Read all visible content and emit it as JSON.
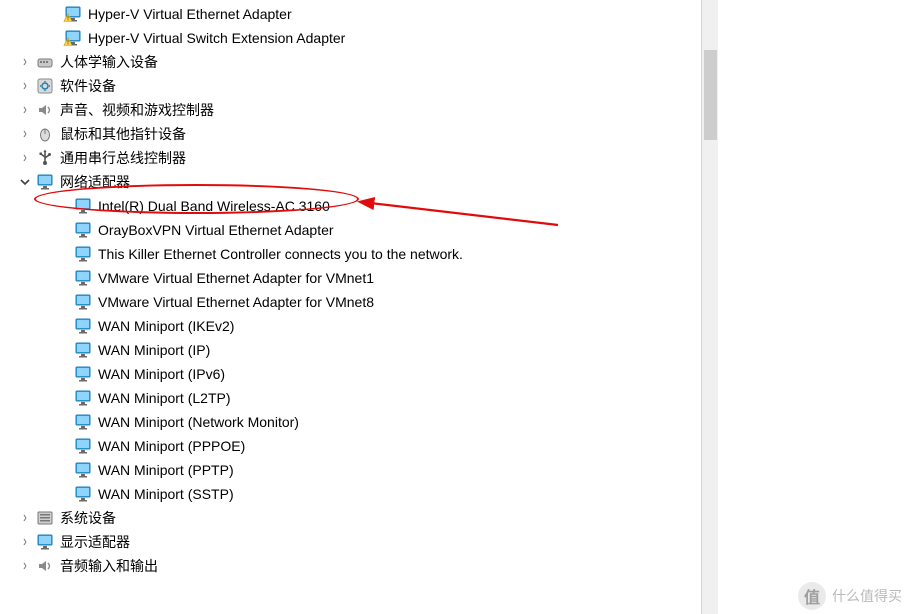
{
  "tree": {
    "items": [
      {
        "indent": 46,
        "chev": "",
        "icon": "net-warn",
        "label": "Hyper-V Virtual Ethernet Adapter"
      },
      {
        "indent": 46,
        "chev": "",
        "icon": "net-warn",
        "label": "Hyper-V Virtual Switch Extension Adapter"
      },
      {
        "indent": 18,
        "chev": "right",
        "icon": "hid",
        "label": "人体学输入设备"
      },
      {
        "indent": 18,
        "chev": "right",
        "icon": "software",
        "label": "软件设备"
      },
      {
        "indent": 18,
        "chev": "right",
        "icon": "audio",
        "label": "声音、视频和游戏控制器"
      },
      {
        "indent": 18,
        "chev": "right",
        "icon": "mouse",
        "label": "鼠标和其他指针设备"
      },
      {
        "indent": 18,
        "chev": "right",
        "icon": "usb",
        "label": "通用串行总线控制器"
      },
      {
        "indent": 18,
        "chev": "down",
        "icon": "network",
        "label": "网络适配器"
      },
      {
        "indent": 56,
        "chev": "",
        "icon": "net-item",
        "label": "Intel(R) Dual Band Wireless-AC 3160"
      },
      {
        "indent": 56,
        "chev": "",
        "icon": "net-item",
        "label": "OrayBoxVPN Virtual Ethernet Adapter"
      },
      {
        "indent": 56,
        "chev": "",
        "icon": "net-item",
        "label": "This Killer Ethernet Controller connects you to the network."
      },
      {
        "indent": 56,
        "chev": "",
        "icon": "net-item",
        "label": "VMware Virtual Ethernet Adapter for VMnet1"
      },
      {
        "indent": 56,
        "chev": "",
        "icon": "net-item",
        "label": "VMware Virtual Ethernet Adapter for VMnet8"
      },
      {
        "indent": 56,
        "chev": "",
        "icon": "net-item",
        "label": "WAN Miniport (IKEv2)"
      },
      {
        "indent": 56,
        "chev": "",
        "icon": "net-item",
        "label": "WAN Miniport (IP)"
      },
      {
        "indent": 56,
        "chev": "",
        "icon": "net-item",
        "label": "WAN Miniport (IPv6)"
      },
      {
        "indent": 56,
        "chev": "",
        "icon": "net-item",
        "label": "WAN Miniport (L2TP)"
      },
      {
        "indent": 56,
        "chev": "",
        "icon": "net-item",
        "label": "WAN Miniport (Network Monitor)"
      },
      {
        "indent": 56,
        "chev": "",
        "icon": "net-item",
        "label": "WAN Miniport (PPPOE)"
      },
      {
        "indent": 56,
        "chev": "",
        "icon": "net-item",
        "label": "WAN Miniport (PPTP)"
      },
      {
        "indent": 56,
        "chev": "",
        "icon": "net-item",
        "label": "WAN Miniport (SSTP)"
      },
      {
        "indent": 18,
        "chev": "right",
        "icon": "system",
        "label": "系统设备"
      },
      {
        "indent": 18,
        "chev": "right",
        "icon": "display",
        "label": "显示适配器"
      },
      {
        "indent": 18,
        "chev": "right",
        "icon": "audio-io",
        "label": "音频输入和输出"
      }
    ]
  },
  "watermark": {
    "text": "什么值得买",
    "badge": "值"
  }
}
